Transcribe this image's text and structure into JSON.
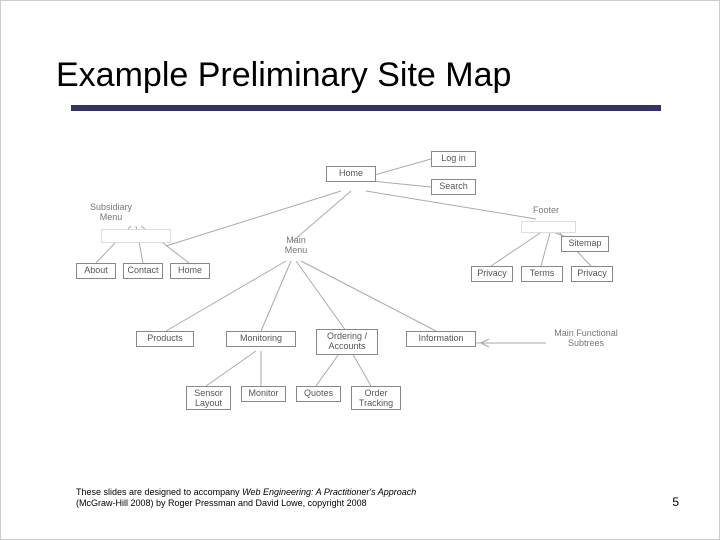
{
  "slide": {
    "title": "Example Preliminary Site Map",
    "page_number": "5"
  },
  "footer": {
    "line1_prefix": "These slides are designed to accompany ",
    "book_title": "Web Engineering: A Practitioner's Approach",
    "line2": "(McGraw-Hill 2008) by Roger Pressman and David Lowe, copyright 2008"
  },
  "diagram": {
    "nodes": {
      "home": "Home",
      "login": "Log in",
      "search": "Search",
      "subsidiary_menu": "Subsidiary Menu",
      "main_menu": "Main Menu",
      "footer_label": "Footer",
      "sitemap": "Sitemap",
      "about": "About",
      "contact": "Contact",
      "home2": "Home",
      "privacy": "Privacy",
      "terms": "Terms",
      "privacy2": "Privacy",
      "products": "Products",
      "monitoring": "Monitoring",
      "ordering_accounts": "Ordering / Accounts",
      "information": "Information",
      "main_functional_subtrees": "Main Functional Subtrees",
      "sensor_layout": "Sensor Layout",
      "monitor": "Monitor",
      "quotes": "Quotes",
      "order_tracking": "Order Tracking"
    }
  }
}
